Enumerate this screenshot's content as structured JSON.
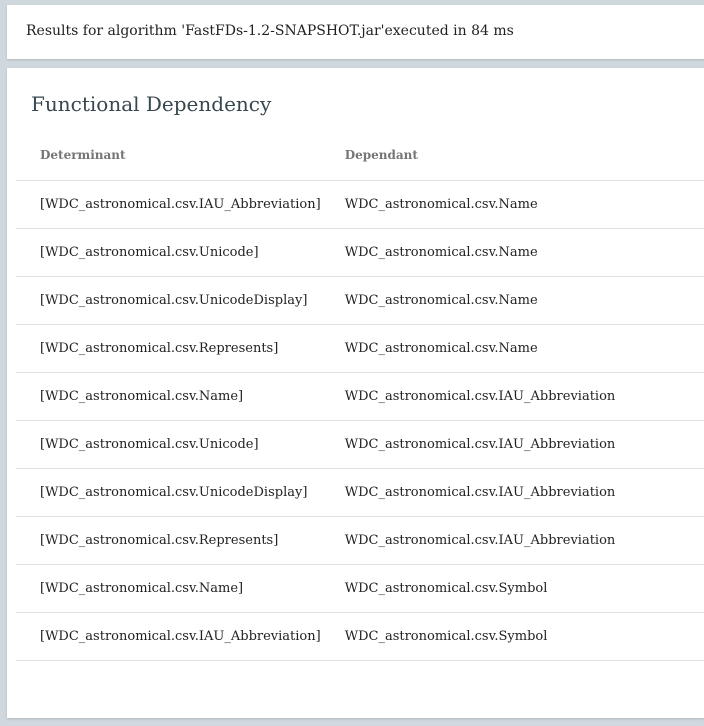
{
  "status": {
    "text": "Results for algorithm 'FastFDs-1.2-SNAPSHOT.jar'executed in 84 ms"
  },
  "results": {
    "title": "Functional Dependency",
    "columns": {
      "determinant": "Determinant",
      "dependant": "Dependant"
    },
    "rows": [
      {
        "determinant": "[WDC_astronomical.csv.IAU_Abbreviation]",
        "dependant": "WDC_astronomical.csv.Name"
      },
      {
        "determinant": "[WDC_astronomical.csv.Unicode]",
        "dependant": "WDC_astronomical.csv.Name"
      },
      {
        "determinant": "[WDC_astronomical.csv.UnicodeDisplay]",
        "dependant": "WDC_astronomical.csv.Name"
      },
      {
        "determinant": "[WDC_astronomical.csv.Represents]",
        "dependant": "WDC_astronomical.csv.Name"
      },
      {
        "determinant": "[WDC_astronomical.csv.Name]",
        "dependant": "WDC_astronomical.csv.IAU_Abbreviation"
      },
      {
        "determinant": "[WDC_astronomical.csv.Unicode]",
        "dependant": "WDC_astronomical.csv.IAU_Abbreviation"
      },
      {
        "determinant": "[WDC_astronomical.csv.UnicodeDisplay]",
        "dependant": "WDC_astronomical.csv.IAU_Abbreviation"
      },
      {
        "determinant": "[WDC_astronomical.csv.Represents]",
        "dependant": "WDC_astronomical.csv.IAU_Abbreviation"
      },
      {
        "determinant": "[WDC_astronomical.csv.Name]",
        "dependant": "WDC_astronomical.csv.Symbol"
      },
      {
        "determinant": "[WDC_astronomical.csv.IAU_Abbreviation]",
        "dependant": "WDC_astronomical.csv.Symbol"
      }
    ]
  }
}
